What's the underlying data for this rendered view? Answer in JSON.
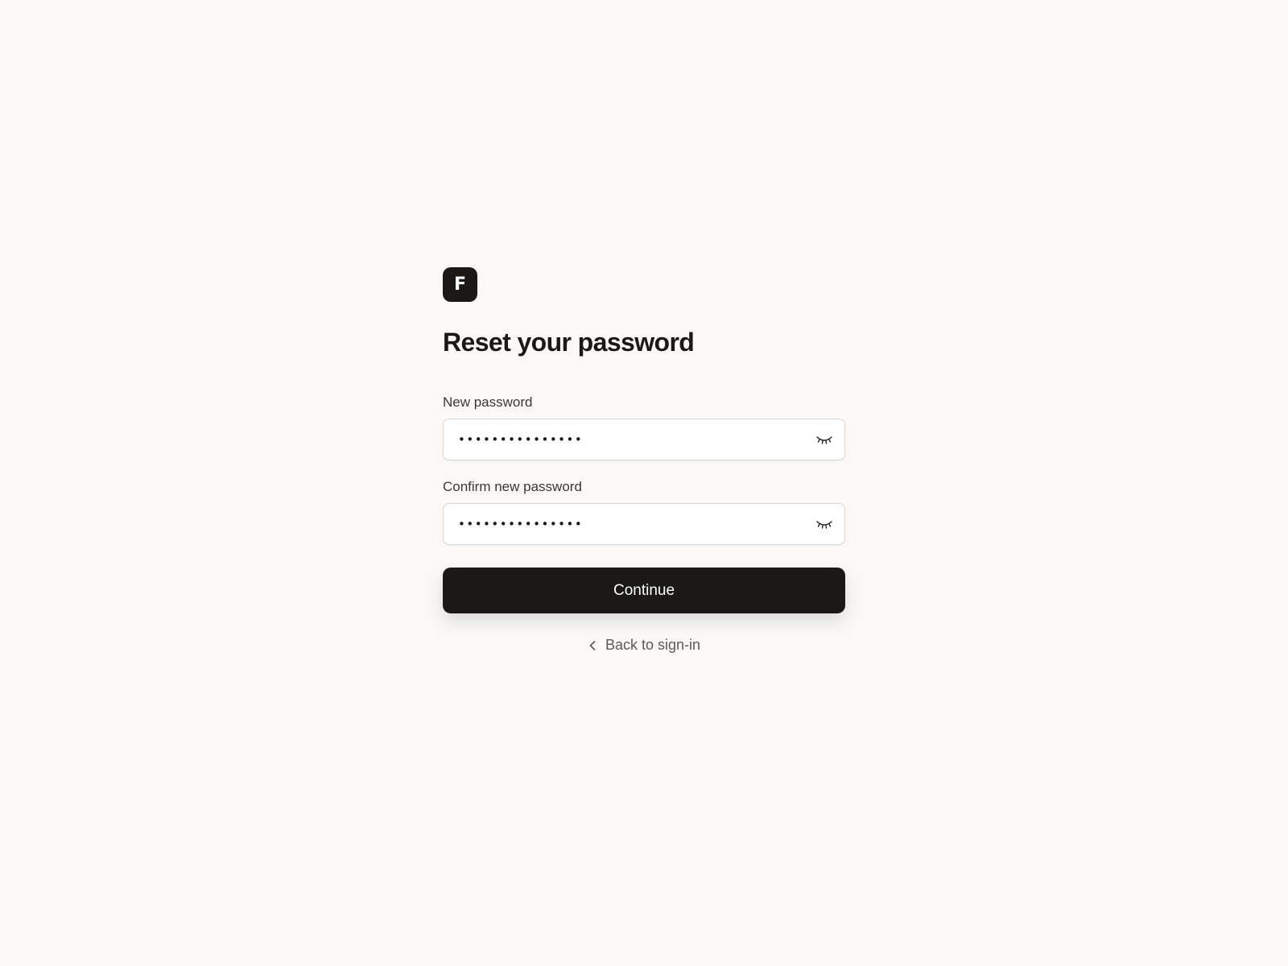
{
  "brand": {
    "logo_letter": "F",
    "logo_color": "#1a1916"
  },
  "form": {
    "title": "Reset your password",
    "new_password": {
      "label": "New password",
      "value": "•••••••••••••••",
      "toggle_icon": "eye-closed-icon"
    },
    "confirm_password": {
      "label": "Confirm new password",
      "value": "•••••••••••••••",
      "toggle_icon": "eye-closed-icon"
    },
    "continue_label": "Continue",
    "back_label": "Back to sign-in",
    "back_icon": "chevron-left-icon"
  },
  "colors": {
    "background": "#faf9f7",
    "primary": "#1a1916",
    "muted_text": "#5c5a55"
  }
}
